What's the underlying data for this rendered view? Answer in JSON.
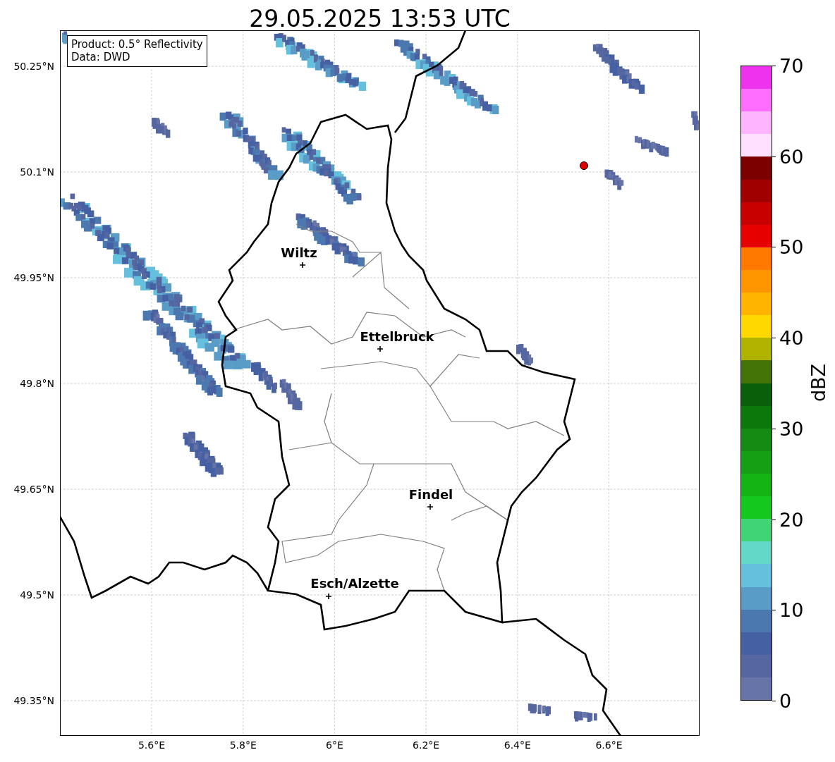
{
  "title": "29.05.2025 13:53 UTC",
  "map": {
    "info_lines": [
      "Product: 0.5° Reflectivity",
      "Data: DWD"
    ],
    "lat_ticks": [
      "50.25°N",
      "50.1°N",
      "49.95°N",
      "49.8°N",
      "49.65°N",
      "49.5°N",
      "49.35°N"
    ],
    "lon_ticks": [
      "5.6°E",
      "5.8°E",
      "6°E",
      "6.2°E",
      "6.4°E",
      "6.6°E"
    ],
    "places": [
      {
        "name": "Wiltz"
      },
      {
        "name": "Ettelbruck"
      },
      {
        "name": "Findel"
      },
      {
        "name": "Esch/Alzette"
      }
    ]
  },
  "colorbar": {
    "label": "dBZ",
    "ticks": [
      "70",
      "60",
      "50",
      "40",
      "30",
      "20",
      "10",
      "0"
    ],
    "bands": [
      {
        "color": "#ee32ee"
      },
      {
        "color": "#ff6eff"
      },
      {
        "color": "#ffb4ff"
      },
      {
        "color": "#ffe0ff"
      },
      {
        "color": "#7c0000"
      },
      {
        "color": "#a00000"
      },
      {
        "color": "#c80000"
      },
      {
        "color": "#e60000"
      },
      {
        "color": "#ff7800"
      },
      {
        "color": "#ff9600"
      },
      {
        "color": "#ffb400"
      },
      {
        "color": "#ffd800"
      },
      {
        "color": "#b0b400"
      },
      {
        "color": "#447408"
      },
      {
        "color": "#0a600a"
      },
      {
        "color": "#0c780c"
      },
      {
        "color": "#148c14"
      },
      {
        "color": "#14a014"
      },
      {
        "color": "#14b414"
      },
      {
        "color": "#14c81e"
      },
      {
        "color": "#40d474"
      },
      {
        "color": "#64d8c8"
      },
      {
        "color": "#64c0dc"
      },
      {
        "color": "#5a9cc8"
      },
      {
        "color": "#4c78b0"
      },
      {
        "color": "#4660a4"
      },
      {
        "color": "#5566a0"
      },
      {
        "color": "#6674a8"
      }
    ]
  }
}
